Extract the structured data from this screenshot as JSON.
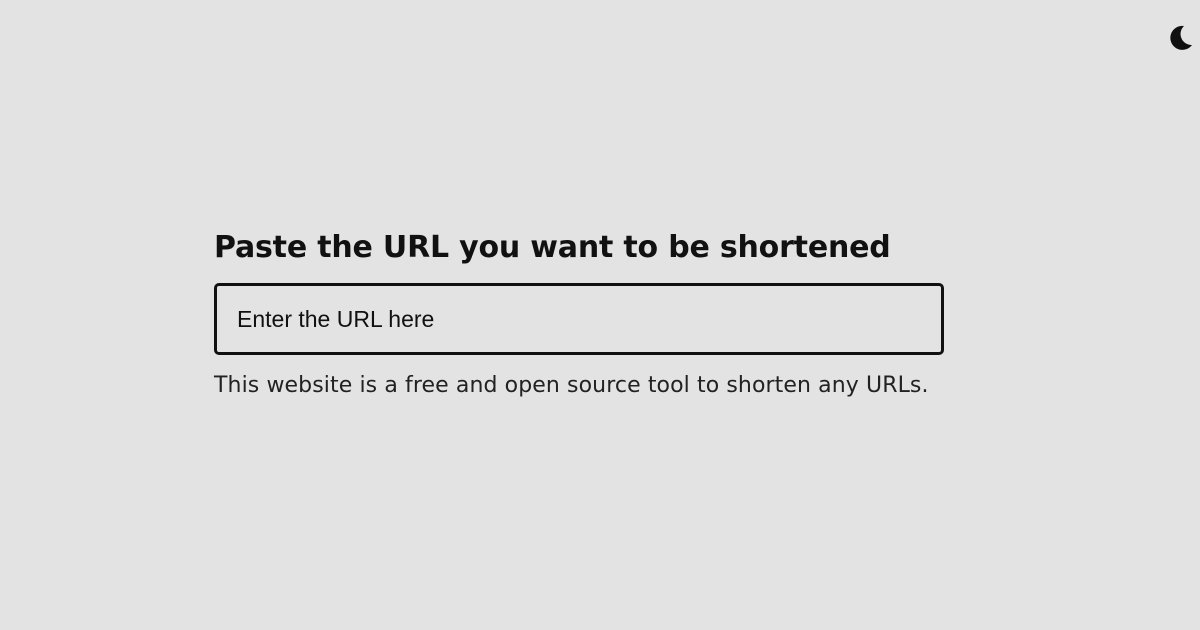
{
  "header": {
    "theme_toggle_icon": "moon-icon"
  },
  "main": {
    "heading": "Paste the URL you want to be shortened",
    "url_input": {
      "placeholder": "Enter the URL here",
      "value": ""
    },
    "description": "This website is a free and open source tool to shorten any URLs."
  },
  "colors": {
    "background": "#e3e3e3",
    "text": "#111111",
    "border": "#111111"
  }
}
